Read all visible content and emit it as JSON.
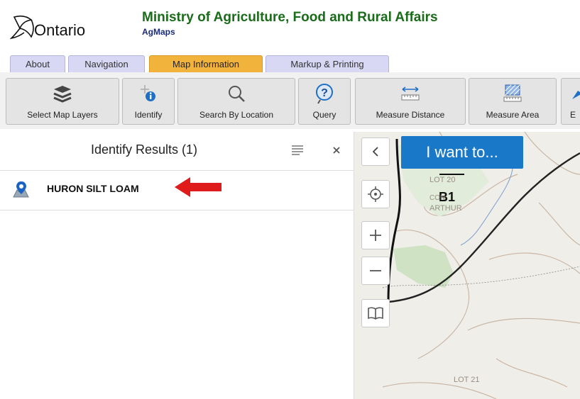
{
  "header": {
    "logo_text": "Ontario",
    "ministry": "Ministry of Agriculture, Food and Rural Affairs",
    "app_name": "AgMaps"
  },
  "tabs": [
    {
      "label": "About"
    },
    {
      "label": "Navigation"
    },
    {
      "label": "Map Information",
      "active": true
    },
    {
      "label": "Markup & Printing"
    }
  ],
  "toolbar": {
    "items": [
      {
        "label": "Select Map Layers",
        "icon": "layers-icon"
      },
      {
        "label": "Identify",
        "icon": "identify-icon"
      },
      {
        "label": "Search By Location",
        "icon": "search-icon"
      },
      {
        "label": "Query",
        "icon": "query-icon"
      },
      {
        "label": "Measure Distance",
        "icon": "ruler-icon"
      },
      {
        "label": "Measure Area",
        "icon": "area-icon"
      },
      {
        "label": "E"
      }
    ]
  },
  "panel": {
    "title": "Identify Results (1)",
    "results": [
      {
        "label": "HURON SILT LOAM",
        "icon": "map-pin-icon"
      }
    ]
  },
  "map": {
    "i_want_to": "I want to...",
    "labels": {
      "b1": "B1",
      "lot20": "LOT 20",
      "arthur": "ARTHUR",
      "lot21": "LOT 21",
      "con": "CON"
    }
  },
  "colors": {
    "ministry_green": "#1a6b1a",
    "active_tab": "#f2b33d",
    "i_want_button": "#1a78c8",
    "arrow": "#e01b1b"
  }
}
